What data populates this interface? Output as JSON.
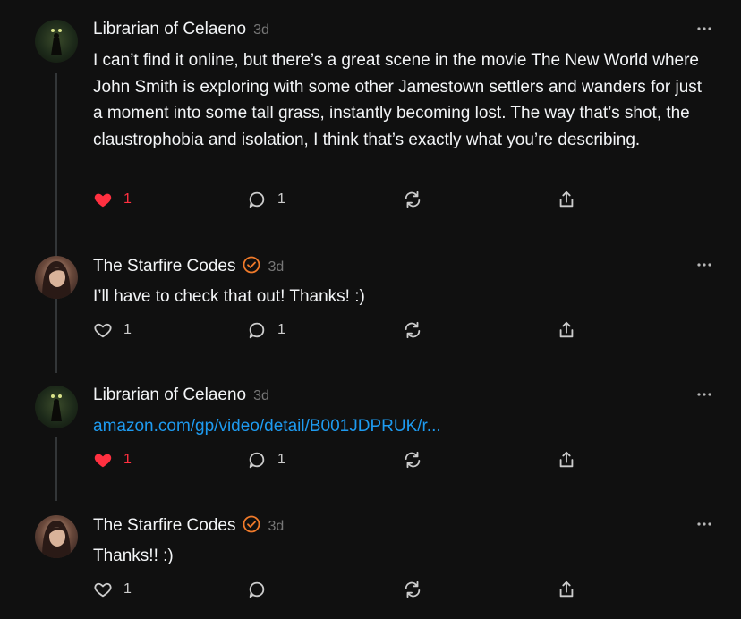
{
  "posts": [
    {
      "author": "Librarian of Celaeno",
      "verified": false,
      "time": "3d",
      "text": "I can’t find it online, but there’s a great scene in the movie The New World where John Smith is exploring with some other Jamestown settlers and wanders for just a moment into some tall grass, instantly becoming lost. The way that’s shot, the claustrophobia and isolation, I think that’s exactly what you’re describing.",
      "likes": "1",
      "liked": true,
      "replies": "1"
    },
    {
      "author": "The Starfire Codes",
      "verified": true,
      "time": "3d",
      "text": "I’ll have to check that out! Thanks! :)",
      "likes": "1",
      "liked": false,
      "replies": "1"
    },
    {
      "author": "Librarian of Celaeno",
      "verified": false,
      "time": "3d",
      "link": "amazon.com/gp/video/detail/B001JDPRUK/r...",
      "likes": "1",
      "liked": true,
      "replies": "1"
    },
    {
      "author": "The Starfire Codes",
      "verified": true,
      "time": "3d",
      "text": "Thanks!! :)",
      "likes": "1",
      "liked": false,
      "replies": ""
    }
  ],
  "icons": {
    "like": "heart-icon",
    "reply": "comment-bubble-icon",
    "repost": "repost-icon",
    "share": "share-icon",
    "more": "more-options-icon",
    "verified": "verified-badge-icon"
  },
  "colors": {
    "background": "#101010",
    "text": "#f3f5f7",
    "muted": "#777777",
    "liked": "#ff3040",
    "link": "#1e9bf0",
    "verified": "#f07a2a"
  }
}
